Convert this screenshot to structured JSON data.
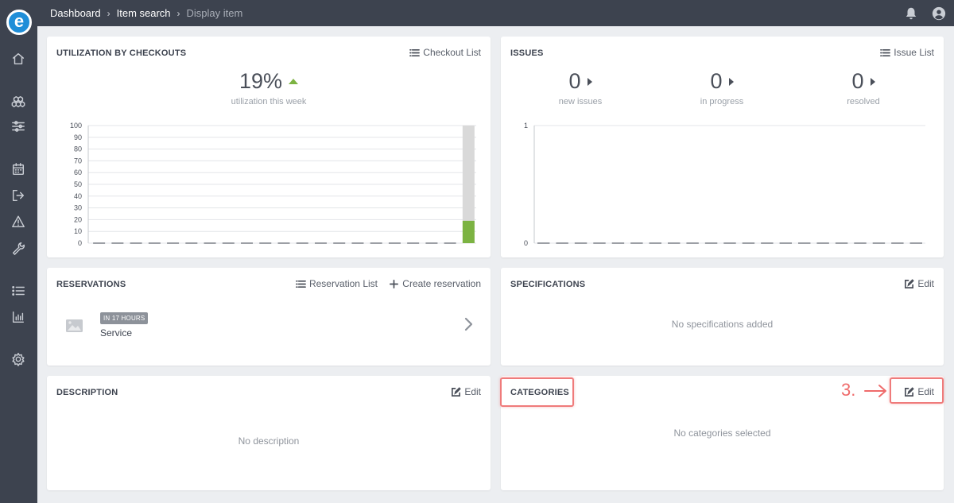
{
  "app": {
    "logo_letter": "e"
  },
  "breadcrumb": [
    {
      "label": "Dashboard"
    },
    {
      "label": "Item search"
    },
    {
      "label": "Display item"
    }
  ],
  "breadcrumb_separator": "›",
  "utilization": {
    "title": "UTILIZATION BY CHECKOUTS",
    "action_label": "Checkout List",
    "value": "19%",
    "subtitle": "utilization this week",
    "chart_data": {
      "type": "bar",
      "ylim": [
        0,
        100
      ],
      "yticks": [
        "100",
        "90",
        "80",
        "70",
        "60",
        "50",
        "40",
        "30",
        "20",
        "10",
        "0"
      ],
      "bar_count": 21,
      "values": [
        0,
        0,
        0,
        0,
        0,
        0,
        0,
        0,
        0,
        0,
        0,
        0,
        0,
        0,
        0,
        0,
        0,
        0,
        0,
        0,
        19
      ],
      "max_values": [
        0,
        0,
        0,
        0,
        0,
        0,
        0,
        0,
        0,
        0,
        0,
        0,
        0,
        0,
        0,
        0,
        0,
        0,
        0,
        0,
        100
      ],
      "colors": {
        "value": "#7cb342",
        "remainder": "#d9d9d9",
        "grid": "#e3e5e8"
      }
    }
  },
  "issues": {
    "title": "ISSUES",
    "action_label": "Issue List",
    "stats": [
      {
        "value": "0",
        "label": "new issues"
      },
      {
        "value": "0",
        "label": "in progress"
      },
      {
        "value": "0",
        "label": "resolved"
      }
    ],
    "chart_data": {
      "type": "line",
      "ylim": [
        0,
        1
      ],
      "yticks": [
        "1",
        "0"
      ],
      "points": 21,
      "values": [
        0,
        0,
        0,
        0,
        0,
        0,
        0,
        0,
        0,
        0,
        0,
        0,
        0,
        0,
        0,
        0,
        0,
        0,
        0,
        0,
        0
      ]
    }
  },
  "reservations": {
    "title": "RESERVATIONS",
    "list_label": "Reservation List",
    "create_label": "Create reservation",
    "items": [
      {
        "badge": "IN 17 HOURS",
        "name": "Service"
      }
    ]
  },
  "specifications": {
    "title": "SPECIFICATIONS",
    "edit_label": "Edit",
    "empty": "No specifications added"
  },
  "description": {
    "title": "DESCRIPTION",
    "edit_label": "Edit",
    "empty": "No description"
  },
  "categories": {
    "title": "CATEGORIES",
    "edit_label": "Edit",
    "empty": "No categories selected",
    "annotation": "3."
  },
  "colors": {
    "sidebar": "#3d434f",
    "accent_green": "#7cb342",
    "highlight": "#ef7b7b",
    "logo": "#1f8ed8"
  }
}
